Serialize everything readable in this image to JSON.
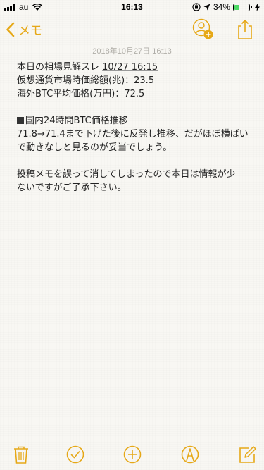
{
  "status_bar": {
    "carrier": "au",
    "time": "16:13",
    "battery_percent": "34%",
    "battery_level": 0.34
  },
  "nav": {
    "back_label": "メモ"
  },
  "note": {
    "date": "2018年10月27日 16:13",
    "line1_text": "本日の相場見解スレ ",
    "line1_link": "10/27 16:15",
    "line2": "仮想通貨市場時価総額(兆)：23.5",
    "line3": "海外BTC平均価格(万円)：72.5",
    "heading": "国内24時間BTC価格推移",
    "para1_line1": "71.8→71.4まで下げた後に反発し推移、だがほぼ横ばい",
    "para1_line2": "で動きなしと見るのが妥当でしょう。",
    "para2_line1": "投稿メモを誤って消してしまったので本日は情報が少",
    "para2_line2": "ないですがご了承下さい。"
  },
  "colors": {
    "accent": "#e6a817",
    "date": "#b0aea8",
    "background": "#f8f7f3"
  },
  "icons": [
    "signal-icon",
    "wifi-icon",
    "lock-rotation-icon",
    "location-icon",
    "battery-icon",
    "charging-icon",
    "back-chevron-icon",
    "add-person-icon",
    "share-icon",
    "trash-icon",
    "checklist-icon",
    "add-icon",
    "sketch-icon",
    "compose-icon"
  ]
}
